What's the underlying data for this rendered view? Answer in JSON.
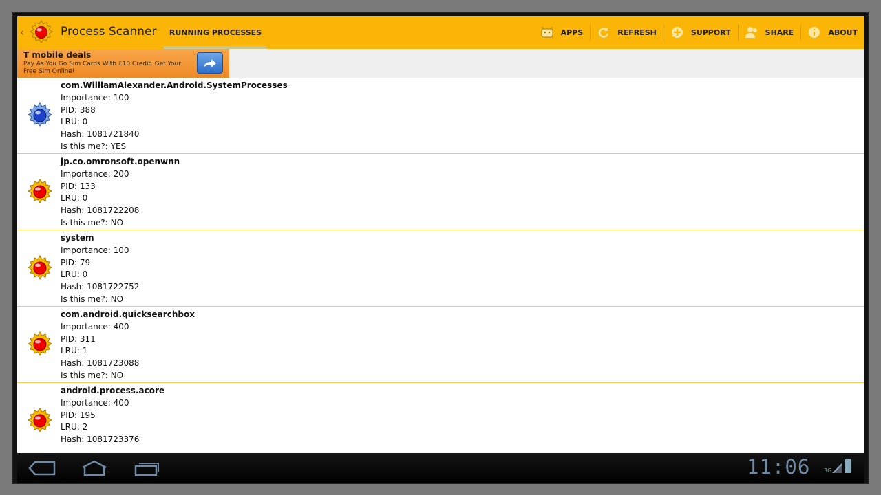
{
  "app": {
    "title": "Process Scanner"
  },
  "tabs": {
    "running": "RUNNING PROCESSES"
  },
  "actions": [
    {
      "label": "APPS",
      "icon": "android-icon"
    },
    {
      "label": "REFRESH",
      "icon": "refresh-icon"
    },
    {
      "label": "SUPPORT",
      "icon": "plus-circle-icon"
    },
    {
      "label": "SHARE",
      "icon": "share-people-icon"
    },
    {
      "label": "ABOUT",
      "icon": "info-icon"
    }
  ],
  "ad": {
    "title": "T mobile deals",
    "text": "Pay As You Go Sim Cards With £10 Credit. Get Your Free Sim Online!",
    "button_icon": "arrow-forward-icon"
  },
  "processes": [
    {
      "name": "com.WilliamAlexander.Android.SystemProcesses",
      "importance": "Importance: 100",
      "pid": "PID: 388",
      "lru": "LRU: 0",
      "hash": "Hash: 1081721840",
      "me": "Is this me?: YES",
      "icon": "blue-gear-icon"
    },
    {
      "name": "jp.co.omronsoft.openwnn",
      "importance": "Importance: 200",
      "pid": "PID: 133",
      "lru": "LRU: 0",
      "hash": "Hash: 1081722208",
      "me": "Is this me?: NO",
      "icon": "red-gear-icon"
    },
    {
      "name": "system",
      "importance": "Importance: 100",
      "pid": "PID: 79",
      "lru": "LRU: 0",
      "hash": "Hash: 1081722752",
      "me": "Is this me?: NO",
      "icon": "red-gear-icon"
    },
    {
      "name": "com.android.quicksearchbox",
      "importance": "Importance: 400",
      "pid": "PID: 311",
      "lru": "LRU: 1",
      "hash": "Hash: 1081723088",
      "me": "Is this me?: NO",
      "icon": "red-gear-icon"
    },
    {
      "name": "android.process.acore",
      "importance": "Importance: 400",
      "pid": "PID: 195",
      "lru": "LRU: 2",
      "hash": "Hash: 1081723376",
      "me": "",
      "icon": "red-gear-icon"
    }
  ],
  "status": {
    "time": "11:06",
    "network": "3G"
  },
  "colors": {
    "actionbar": "#fbb507",
    "divider": "#fbc84a",
    "ad": "#ef8a25"
  }
}
